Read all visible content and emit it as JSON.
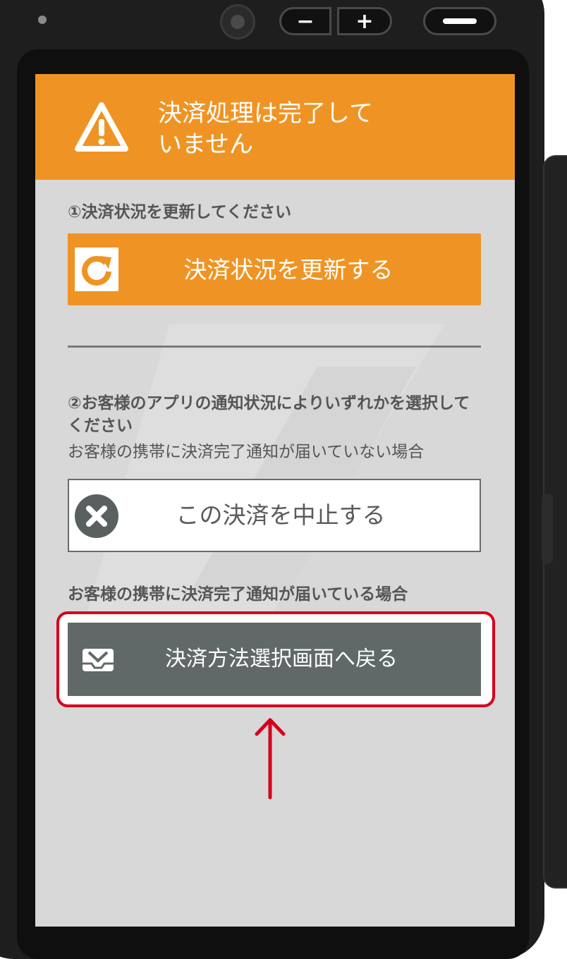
{
  "header": {
    "icon": "warning-icon",
    "title": "決済処理は完了して\nいません"
  },
  "step1": {
    "label": "①決済状況を更新してください",
    "refresh_button": {
      "label": "決済状況を更新する",
      "icon": "refresh-icon"
    }
  },
  "step2": {
    "label": "②お客様のアプリの通知状況によりいずれかを選択してください",
    "case_not_received": "お客様の携帯に決済完了通知が届いていない場合",
    "cancel_button": {
      "label": "この決済を中止する",
      "icon": "close-circle-icon"
    },
    "case_received": "お客様の携帯に決済完了通知が届いている場合",
    "back_button": {
      "label": "決済方法選択画面へ戻る",
      "icon": "payment-method-icon"
    }
  },
  "colors": {
    "accent": "#ef9424",
    "screen_bg": "#d8d8d8",
    "back_button": "#616868",
    "highlight": "#d6001c"
  },
  "hardware_buttons": {
    "minus": "−",
    "plus": "+"
  }
}
